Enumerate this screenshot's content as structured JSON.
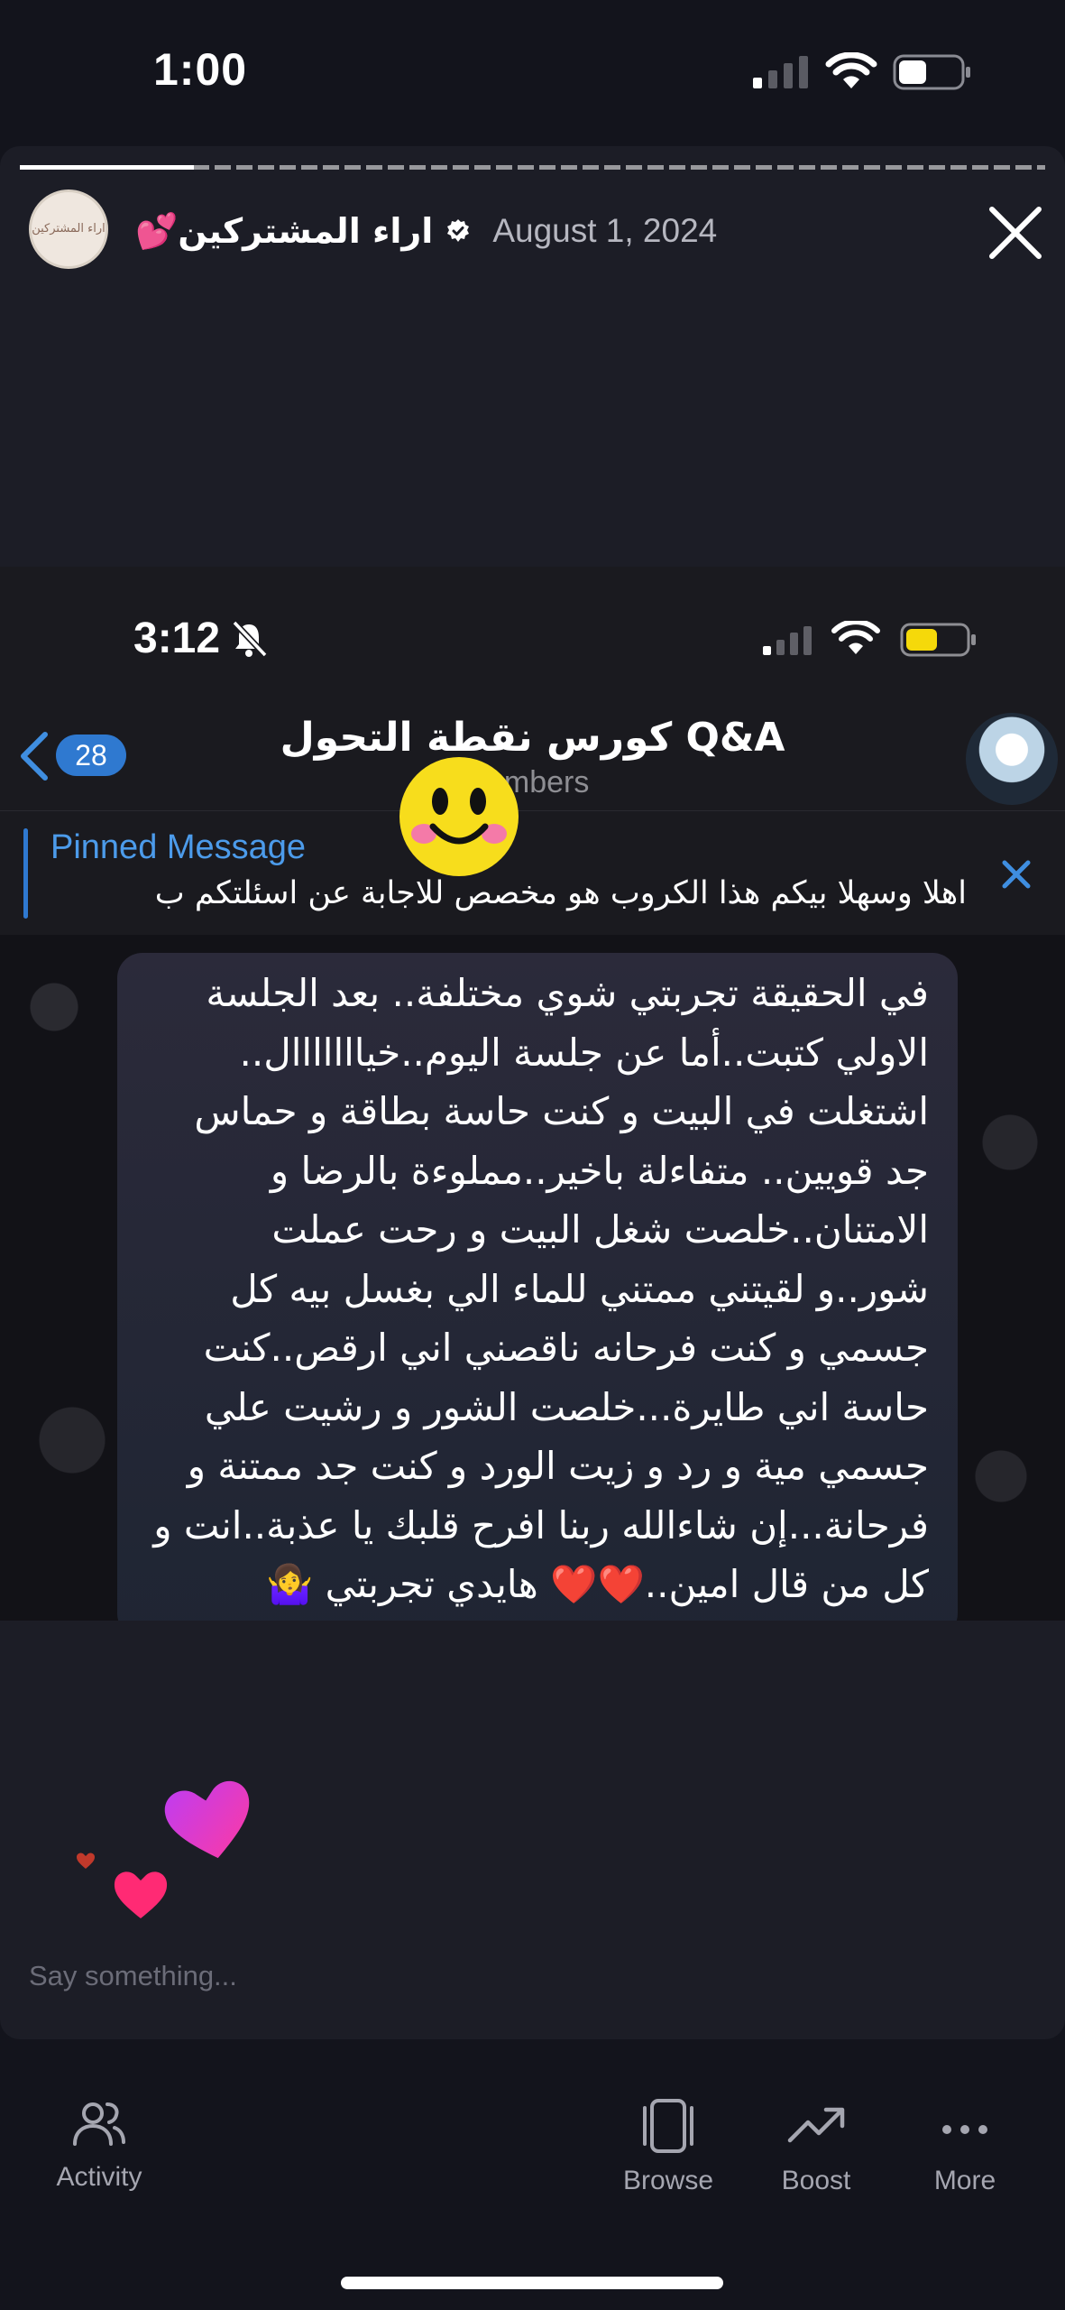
{
  "status_bar": {
    "time": "1:00"
  },
  "story": {
    "author_name": "💕اراء المشتركين",
    "author_avatar_text": "اراء المشتركين",
    "date": "August 1, 2024",
    "progress_fraction": 0.17
  },
  "embedded": {
    "time": "3:12",
    "back_count": "28",
    "group_title": "كورس نقطة التحول Q&A",
    "group_subtitle": "embers",
    "pinned_title": "Pinned Message",
    "pinned_text": "اهلا وسهلا بيكم هذا الكروب هو مخصص للاجابة عن اسئلتكم ب",
    "message_lines": [
      "في الحقيقة تجربتي شوي مختلفة.. بعد الجلسة",
      "الاولي كتبت..أما عن جلسة اليوم..خيااااااال..",
      "اشتغلت في البيت و كنت حاسة بطاقة و حماس",
      "جد قويين.. متفاءلة باخير..مملوءة بالرضا و",
      "الامتنان..خلصت شغل البيت و رحت عملت",
      "شور..و لقيتني ممتني للماء الي بغسل بيه كل",
      "جسمي و كنت فرحانه ناقصني اني ارقص..كنت",
      "حاسة اني طايرة...خلصت الشور و رشيت علي",
      "جسمي مية و رد و زيت الورد و كنت جد ممتنة و",
      "فرحانة...إن شاءالله ربنا افرح قلبك يا عذبة..انت و",
      "كل من قال امين..❤️❤️ هايدي تجربتي 🤷‍♀️"
    ]
  },
  "reply": {
    "placeholder": "Say something..."
  },
  "bottom_nav": [
    {
      "label": "Activity",
      "icon": "people-icon"
    },
    {
      "label": "Browse",
      "icon": "cards-icon"
    },
    {
      "label": "Boost",
      "icon": "trend-up-icon"
    },
    {
      "label": "More",
      "icon": "ellipsis-icon"
    }
  ],
  "colors": {
    "accent": "#2f79d0",
    "background": "#13141c",
    "card": "#1c1d26"
  }
}
